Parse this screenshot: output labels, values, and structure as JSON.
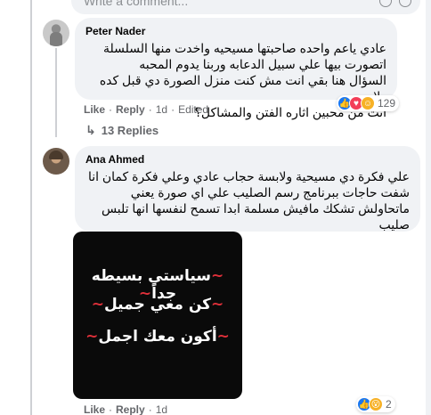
{
  "composer": {
    "placeholder": "Write a comment..."
  },
  "comment1": {
    "author": "Peter Nader",
    "text_lines": [
      "عادي ياعم واحده صاحبتها مسيحيه واخدت منها السلسلة",
      "اتصورت بيها علي سبيل الدعابه وربنا يدوم المحبه",
      "السؤال هنا بقي انت مش كنت منزل الصورة دي قبل كده ولا",
      "انت من محبين اثاره الفتن والمشاكل؟"
    ],
    "like": "Like",
    "reply": "Reply",
    "time": "1d",
    "edited": "Edited",
    "reaction_count": "129",
    "reactions": [
      "like",
      "love",
      "haha"
    ]
  },
  "replies_toggle": {
    "label": "13 Replies"
  },
  "comment2": {
    "author": "Ana Ahmed",
    "text_lines": [
      "علي فكرة دي مسيحية ولابسة حجاب عادي وعلي فكرة كمان انا",
      "شفت حاجات ببرنامج رسم الصليب علي اي صورة يعني",
      "ماتحاولش تشكك مافيش مسلمة ابدا تسمح لنفسها انها تلبس",
      "صليب"
    ],
    "image_text": {
      "line1": "سياستي بسيطه جداً",
      "line2": "كن معي جميل",
      "line3": "أكون معك اجمل"
    },
    "like": "Like",
    "reply": "Reply",
    "time": "1d",
    "reaction_count": "2",
    "reactions": [
      "like",
      "wow"
    ]
  },
  "colors": {
    "bubble": "#f0f2f5",
    "meta": "#65676b",
    "like_blue": "#1877f2",
    "love_red": "#f33e58",
    "haha_yellow": "#f7b125"
  }
}
